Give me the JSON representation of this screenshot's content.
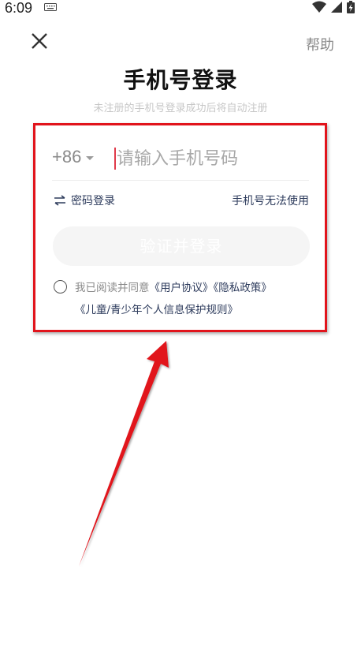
{
  "status_bar": {
    "time": "6:09",
    "icons": [
      "keyboard-icon",
      "wifi-icon",
      "signal-icon",
      "battery-charging-icon"
    ]
  },
  "header": {
    "close_icon": "close-icon",
    "help_label": "帮助"
  },
  "title": "手机号登录",
  "subtitle": "未注册的手机号登录成功后将自动注册",
  "form": {
    "country_code": "+86",
    "phone_placeholder": "请输入手机号码",
    "phone_value": "",
    "password_login_label": "密码登录",
    "phone_unavailable_label": "手机号无法使用",
    "login_button_label": "验证并登录"
  },
  "agreement": {
    "checked": false,
    "prefix": "我已阅读并同意",
    "user_agreement": "《用户协议》",
    "privacy_policy": "《隐私政策》",
    "children_policy": "《儿童/青少年个人信息保护规则》"
  },
  "colors": {
    "accent_link": "#2d3b5c",
    "annotation_red": "#e1141c",
    "cursor_red": "#e03a4a",
    "button_disabled_bg": "#f5f5f5"
  }
}
